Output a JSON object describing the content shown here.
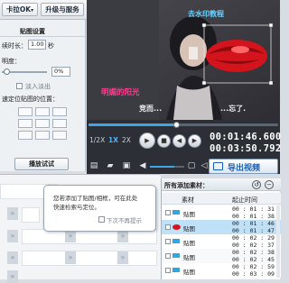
{
  "toolbar": {
    "dropdown_ok": "卡拉OK",
    "upgrade_service": "升级与服务"
  },
  "settings": {
    "section_title": "贴图设置",
    "duration_label": "续时长：",
    "duration_value": "1.00",
    "duration_unit": "秒",
    "opacity_label": "明度：",
    "opacity_value": "0%",
    "fade_label": "淡入淡出",
    "position_label": "速定位贴图的位置：",
    "preview_button": "播放试试"
  },
  "video": {
    "overlay_top_right": "去水印教程",
    "overlay_left": "明媚的阳光",
    "overlay_bottom": "竞而...",
    "overlay_bottom_right": "...忘了."
  },
  "player": {
    "speed_half": "1/2X",
    "speed_1x": "1X",
    "speed_2x": "2X",
    "current_time": "00:01:46.600",
    "total_time": "00:03:50.792",
    "export_button": "导出视频",
    "position_fraction": 0.46,
    "volume_fraction": 0.7
  },
  "tooltip": {
    "text_line1": "您若添加了贴图/相框，可在此处",
    "text_line2": "快速检索与定位。",
    "dont_show_again": "下次不再提示"
  },
  "list": {
    "title": "所有添加素材：",
    "col_material": "素材",
    "col_start": "起止时间",
    "rows": [
      {
        "name": "贴图",
        "start": "00 : 01 : 31",
        "end": "00 : 01 : 38",
        "kind": "blue",
        "selected": false
      },
      {
        "name": "贴图",
        "start": "00 : 01 : 46",
        "end": "00 : 01 : 47",
        "kind": "lips",
        "selected": true
      },
      {
        "name": "贴图",
        "start": "00 : 02 : 29",
        "end": "00 : 02 : 37",
        "kind": "blue",
        "selected": false
      },
      {
        "name": "贴图",
        "start": "00 : 02 : 38",
        "end": "00 : 02 : 45",
        "kind": "blue",
        "selected": false
      },
      {
        "name": "贴图",
        "start": "00 : 02 : 59",
        "end": "00 : 03 : 09",
        "kind": "blue",
        "selected": false
      }
    ]
  },
  "colors": {
    "accent": "#1f6fbf",
    "export_text": "#1a5fb4",
    "selected_row": "#bfe0f6",
    "player_bg": "#2c2f36"
  }
}
